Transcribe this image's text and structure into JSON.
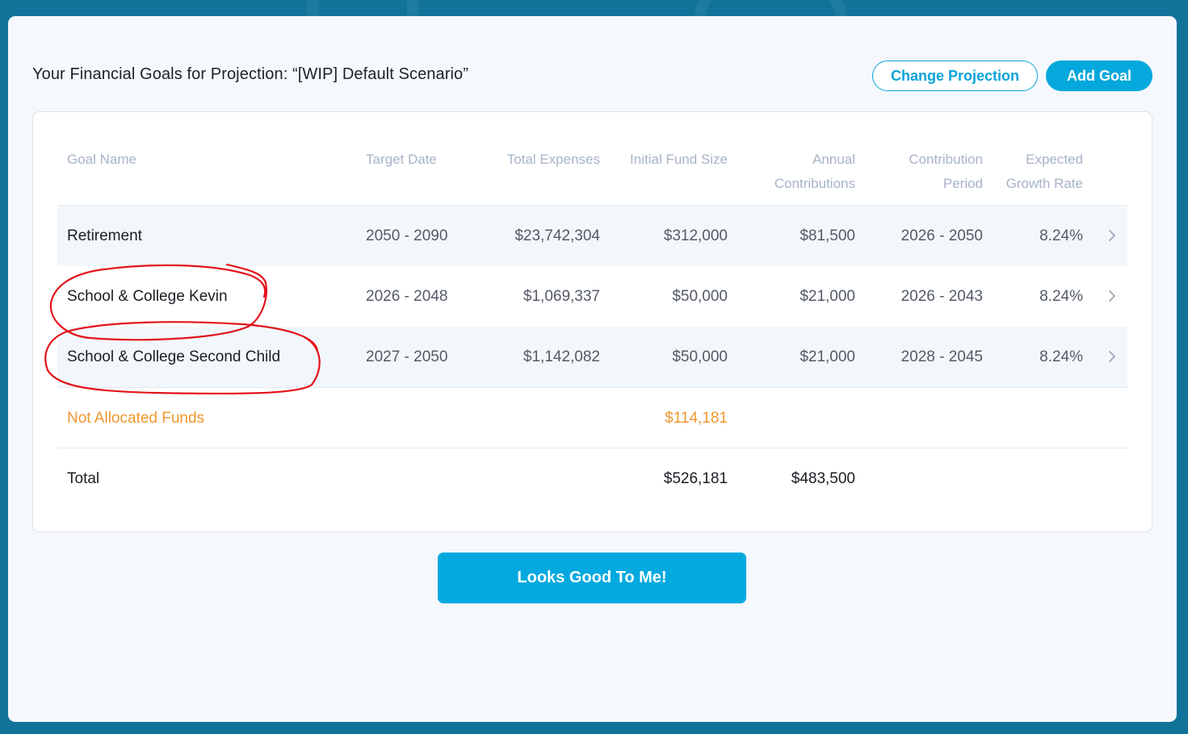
{
  "header": {
    "title": "Your Financial Goals for Projection: “[WIP] Default Scenario”",
    "change_projection_label": "Change Projection",
    "add_goal_label": "Add Goal"
  },
  "table": {
    "columns": {
      "goal_name": "Goal Name",
      "target_date": "Target Date",
      "total_expenses": "Total Expenses",
      "initial_fund_size": "Initial Fund Size",
      "annual_contributions_l1": "Annual",
      "annual_contributions_l2": "Contributions",
      "contribution_period_l1": "Contribution",
      "contribution_period_l2": "Period",
      "expected_growth_rate_l1": "Expected",
      "expected_growth_rate_l2": "Growth Rate"
    },
    "rows": [
      {
        "goal_name": "Retirement",
        "target_date": "2050 - 2090",
        "total_expenses": "$23,742,304",
        "initial_fund_size": "$312,000",
        "annual_contributions": "$81,500",
        "contribution_period": "2026 - 2050",
        "expected_growth_rate": "8.24%"
      },
      {
        "goal_name": "School & College Kevin",
        "target_date": "2026 - 2048",
        "total_expenses": "$1,069,337",
        "initial_fund_size": "$50,000",
        "annual_contributions": "$21,000",
        "contribution_period": "2026 - 2043",
        "expected_growth_rate": "8.24%"
      },
      {
        "goal_name": "School & College Second Child",
        "target_date": "2027 - 2050",
        "total_expenses": "$1,142,082",
        "initial_fund_size": "$50,000",
        "annual_contributions": "$21,000",
        "contribution_period": "2028 - 2045",
        "expected_growth_rate": "8.24%"
      }
    ],
    "not_allocated": {
      "label": "Not Allocated Funds",
      "initial_fund_size": "$114,181"
    },
    "total": {
      "label": "Total",
      "initial_fund_size": "$526,181",
      "annual_contributions": "$483,500"
    }
  },
  "footer": {
    "confirm_label": "Looks Good To Me!"
  },
  "colors": {
    "accent": "#04a8dc",
    "background": "#12739a",
    "not_allocated": "#f0962d",
    "annotation": "#e3131b"
  },
  "icons": {
    "row_chevron": "chevron-right-icon"
  }
}
